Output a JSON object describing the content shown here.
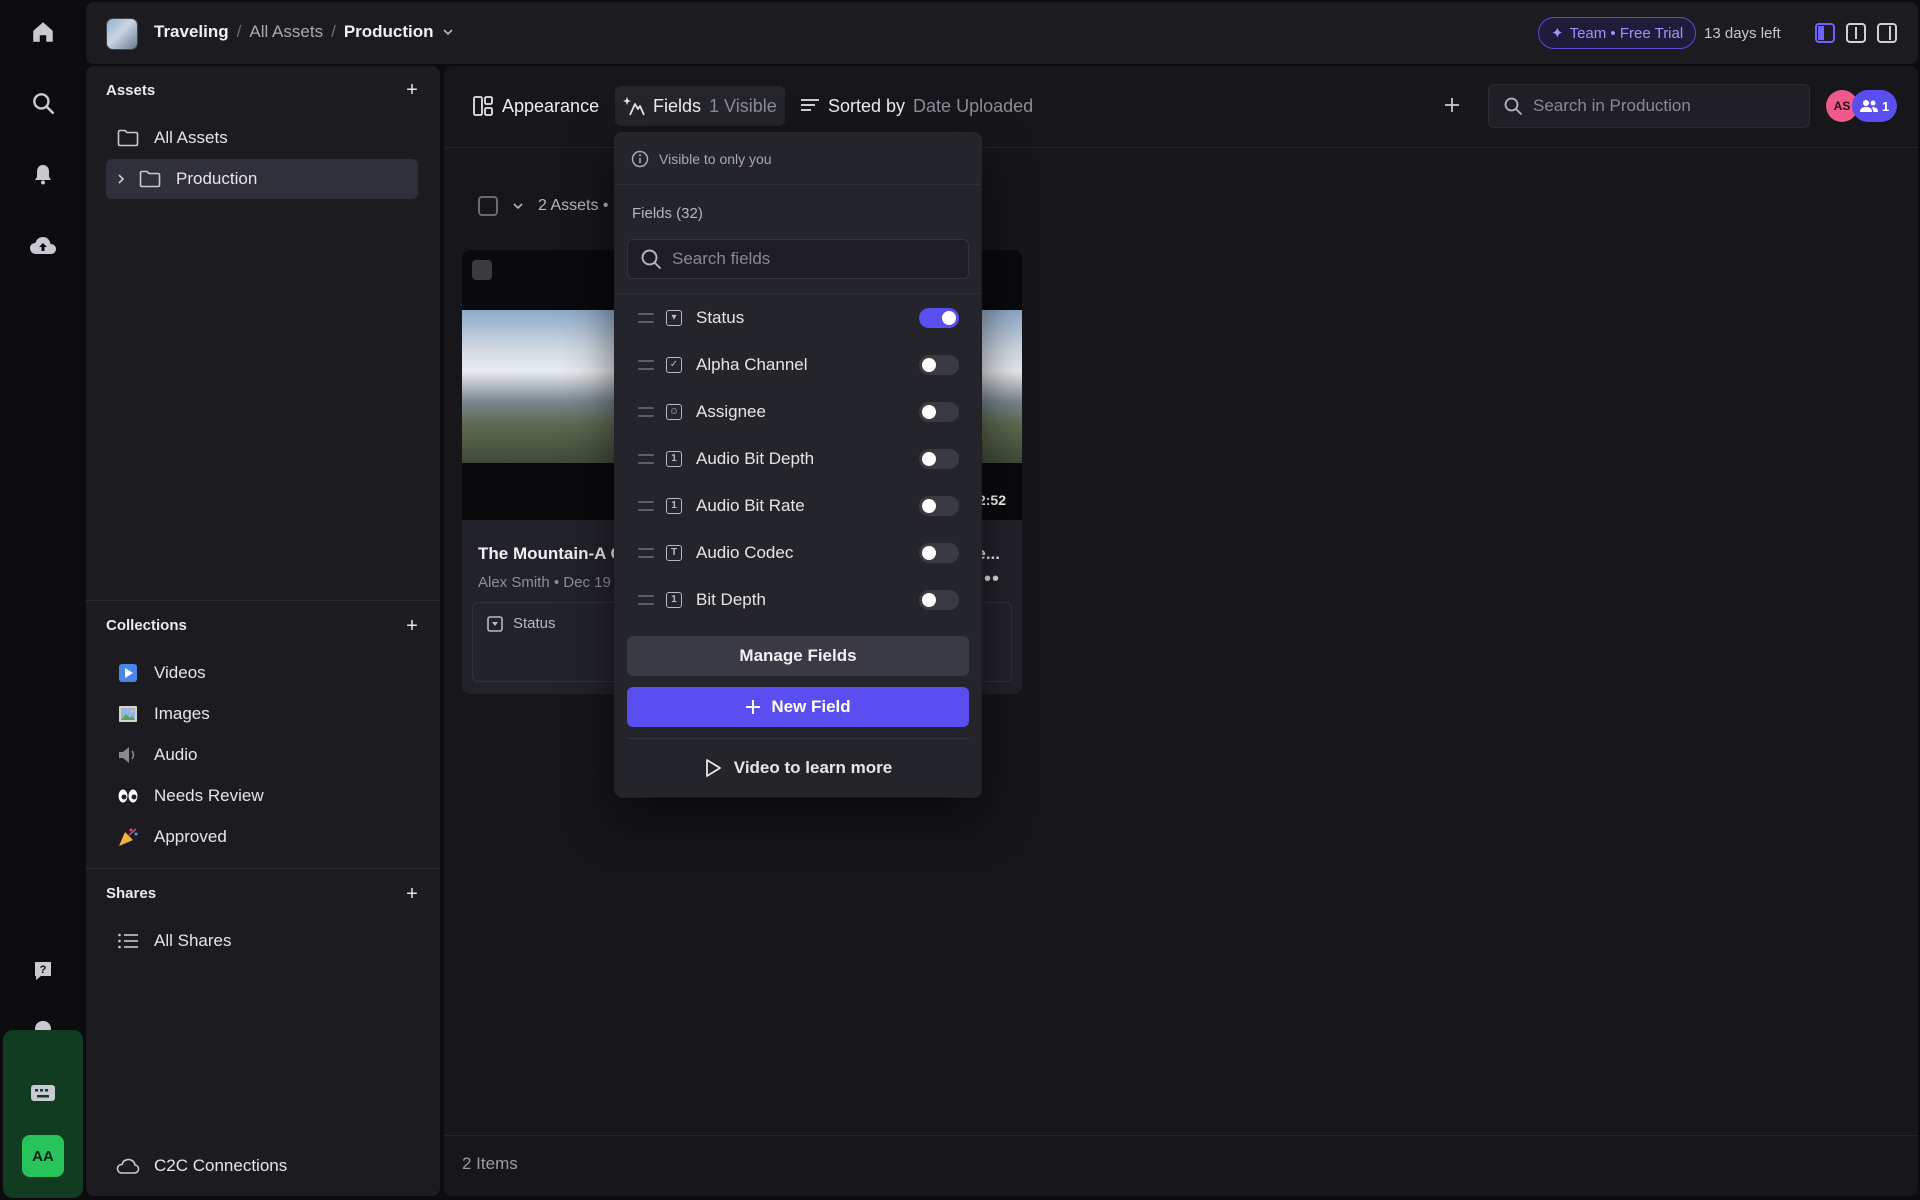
{
  "breadcrumb": {
    "workspace": "Traveling",
    "parent": "All Assets",
    "current": "Production"
  },
  "trial": {
    "badge": "Team • Free Trial",
    "days_left": "13 days left"
  },
  "sidebar": {
    "assets_title": "Assets",
    "assets_items": [
      {
        "label": "All Assets",
        "icon": "folder-icon"
      },
      {
        "label": "Production",
        "icon": "folder-icon",
        "active": true
      }
    ],
    "collections_title": "Collections",
    "collections_items": [
      {
        "label": "Videos",
        "icon": "▶️"
      },
      {
        "label": "Images",
        "icon": "🖼️"
      },
      {
        "label": "Audio",
        "icon": "🔈"
      },
      {
        "label": "Needs Review",
        "icon": "👀"
      },
      {
        "label": "Approved",
        "icon": "🎉"
      }
    ],
    "shares_title": "Shares",
    "shares_items": [
      {
        "label": "All Shares",
        "icon": "list-icon"
      }
    ],
    "c2c": "C2C Connections"
  },
  "rail": {
    "avatar_initials": "AA"
  },
  "toolbar": {
    "appearance": "Appearance",
    "fields": "Fields",
    "fields_count": "1 Visible",
    "sorted_by": "Sorted by",
    "sorted_value": "Date Uploaded",
    "search_placeholder": "Search in Production",
    "avatar_initials": "AS",
    "group_count": "1"
  },
  "content": {
    "selection_label": "2 Assets •",
    "cards": [
      {
        "title": "The Mountain-A C",
        "meta": "Alex Smith • Dec 19",
        "status_label": "Status"
      },
      {
        "title": "e...",
        "duration": "2:52"
      }
    ],
    "items_count": "2 Items"
  },
  "fields_panel": {
    "visibility_note": "Visible to only you",
    "count_label": "Fields (32)",
    "search_placeholder": "Search fields",
    "fields": [
      {
        "label": "Status",
        "icon": "select-icon",
        "glyph": "▾",
        "enabled": true
      },
      {
        "label": "Alpha Channel",
        "icon": "checkbox-icon",
        "glyph": "✓",
        "enabled": false
      },
      {
        "label": "Assignee",
        "icon": "person-icon",
        "glyph": "☺",
        "enabled": false
      },
      {
        "label": "Audio Bit Depth",
        "icon": "number-icon",
        "glyph": "1",
        "enabled": false
      },
      {
        "label": "Audio Bit Rate",
        "icon": "number-icon",
        "glyph": "1",
        "enabled": false
      },
      {
        "label": "Audio Codec",
        "icon": "text-icon",
        "glyph": "T",
        "enabled": false
      },
      {
        "label": "Bit Depth",
        "icon": "number-icon",
        "glyph": "1",
        "enabled": false
      }
    ],
    "manage_label": "Manage Fields",
    "new_field_label": "New Field",
    "learn_label": "Video to learn more"
  }
}
